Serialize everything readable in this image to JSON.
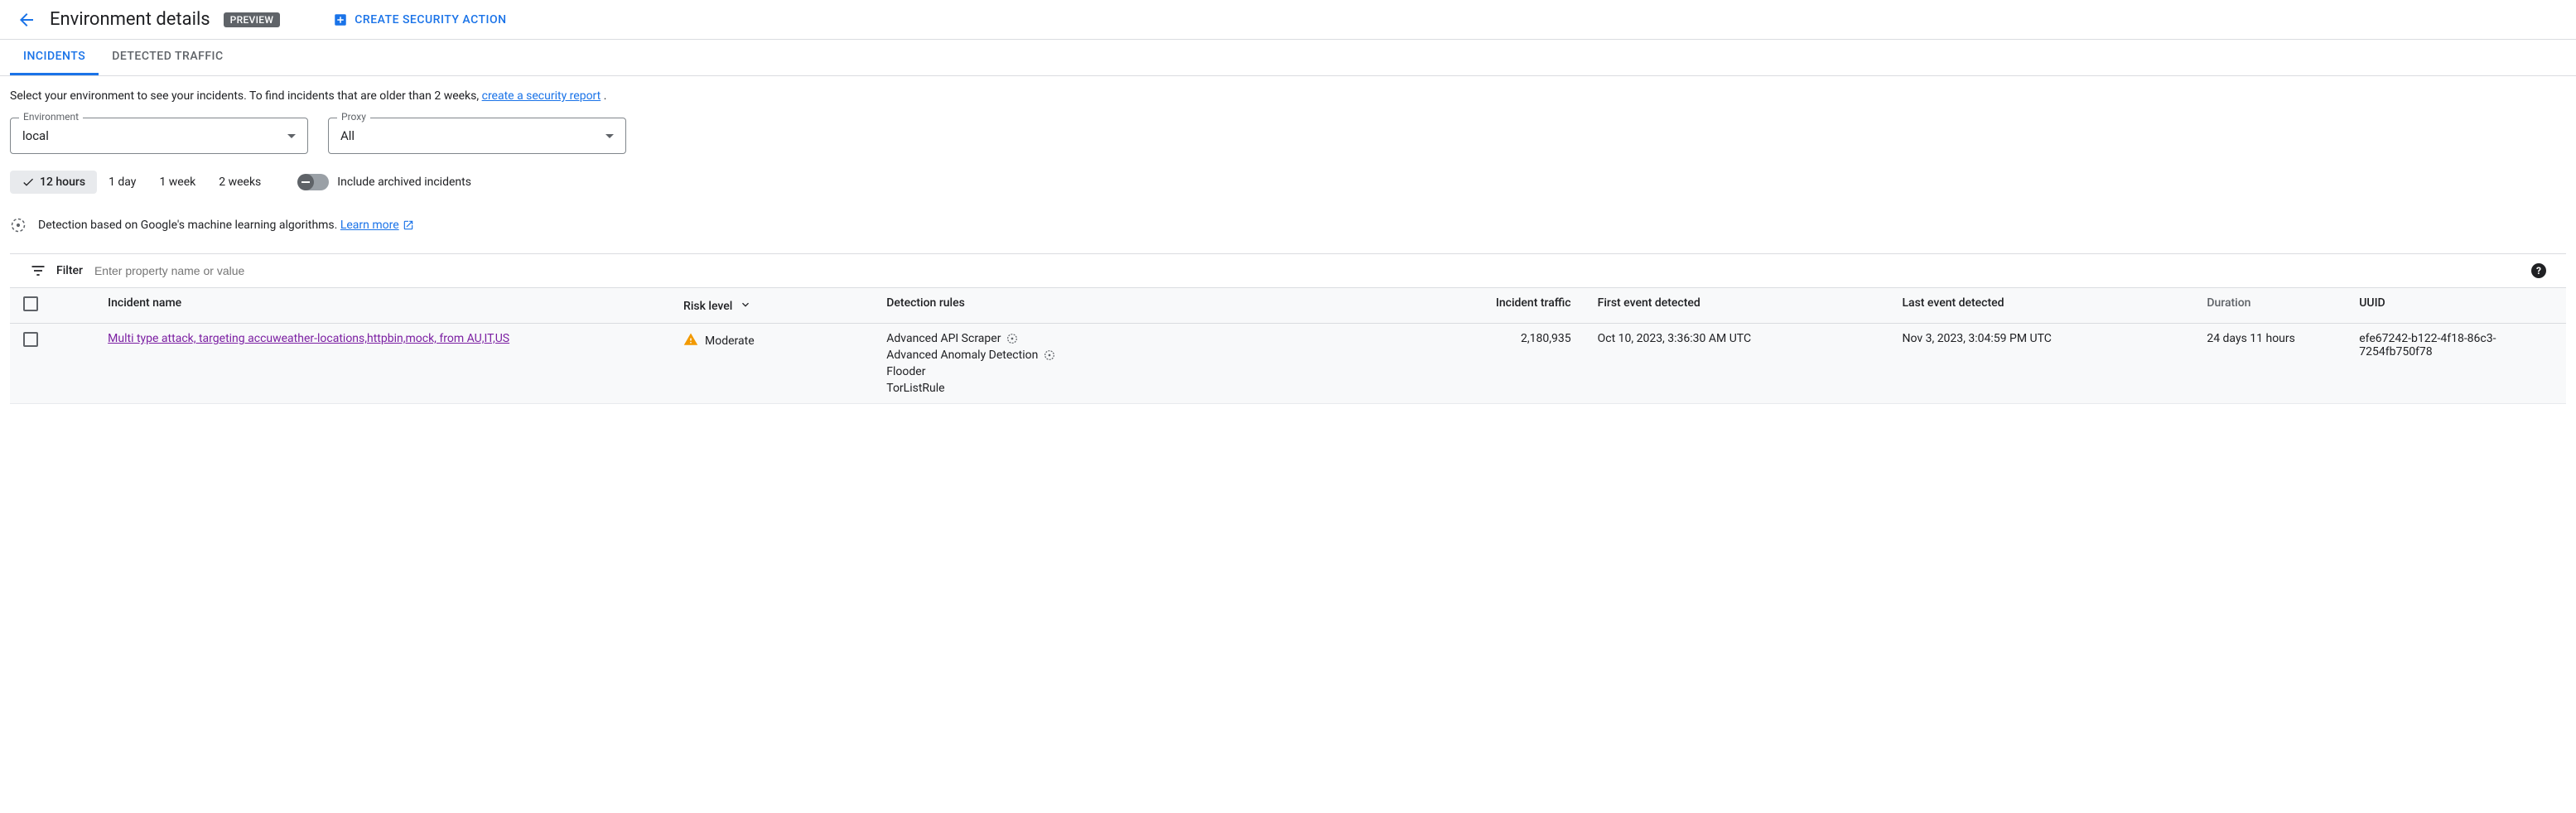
{
  "header": {
    "title": "Environment details",
    "preview_badge": "PREVIEW",
    "create_action": "CREATE SECURITY ACTION"
  },
  "tabs": {
    "incidents": "INCIDENTS",
    "detected_traffic": "DETECTED TRAFFIC"
  },
  "intro": {
    "text_before": "Select your environment to see your incidents. To find incidents that are older than 2 weeks, ",
    "link": "create a security report",
    "text_after": " ."
  },
  "selectors": {
    "environment": {
      "label": "Environment",
      "value": "local"
    },
    "proxy": {
      "label": "Proxy",
      "value": "All"
    }
  },
  "timerange": {
    "opt_12h": "12 hours",
    "opt_1d": "1 day",
    "opt_1w": "1 week",
    "opt_2w": "2 weeks",
    "toggle_label": "Include archived incidents"
  },
  "detection": {
    "text": "Detection based on Google's machine learning algorithms. ",
    "learn_more": "Learn more"
  },
  "filter": {
    "label": "Filter",
    "placeholder": "Enter property name or value"
  },
  "table": {
    "headers": {
      "name": "Incident name",
      "risk": "Risk level",
      "rules": "Detection rules",
      "traffic": "Incident traffic",
      "first": "First event detected",
      "last": "Last event detected",
      "duration": "Duration",
      "uuid": "UUID"
    },
    "row0": {
      "name": "Multi type attack, targeting accuweather-locations,httpbin,mock, from AU,IT,US",
      "risk": "Moderate",
      "rule0": "Advanced API Scraper",
      "rule1": "Advanced Anomaly Detection",
      "rule2": "Flooder",
      "rule3": "TorListRule",
      "traffic": "2,180,935",
      "first": "Oct 10, 2023, 3:36:30 AM UTC",
      "last": "Nov 3, 2023, 3:04:59 PM UTC",
      "duration": "24 days 11 hours",
      "uuid": "efe67242-b122-4f18-86c3-7254fb750f78"
    }
  }
}
